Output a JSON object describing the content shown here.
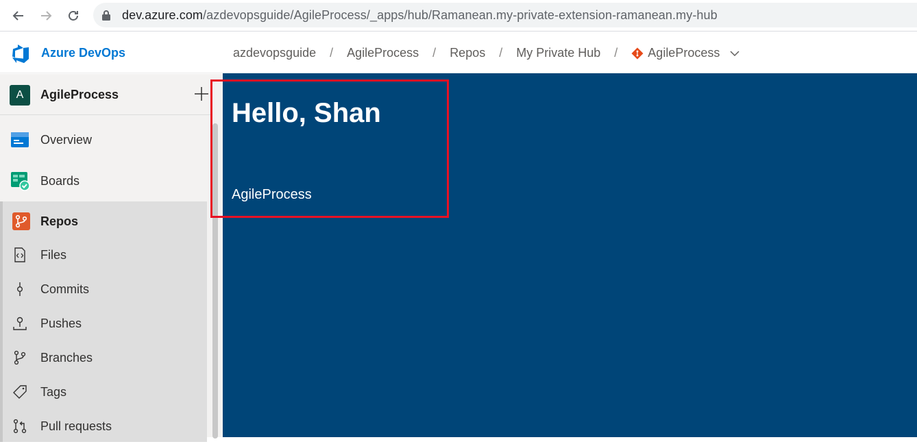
{
  "browser": {
    "url_host": "dev.azure.com",
    "url_path": "/azdevopsguide/AgileProcess/_apps/hub/Ramanean.my-private-extension-ramanean.my-hub"
  },
  "header": {
    "brand": "Azure DevOps",
    "breadcrumbs": [
      "azdevopsguide",
      "AgileProcess",
      "Repos",
      "My Private Hub"
    ],
    "separator": "/",
    "repo": "AgileProcess"
  },
  "sidebar": {
    "project_initial": "A",
    "project_name": "AgileProcess",
    "items": [
      {
        "label": "Overview",
        "icon": "overview-icon"
      },
      {
        "label": "Boards",
        "icon": "boards-icon"
      },
      {
        "label": "Repos",
        "icon": "repos-icon"
      }
    ],
    "sub_items": [
      {
        "label": "Files",
        "icon": "files-icon"
      },
      {
        "label": "Commits",
        "icon": "commits-icon"
      },
      {
        "label": "Pushes",
        "icon": "pushes-icon"
      },
      {
        "label": "Branches",
        "icon": "branches-icon"
      },
      {
        "label": "Tags",
        "icon": "tags-icon"
      },
      {
        "label": "Pull requests",
        "icon": "pull-requests-icon"
      }
    ]
  },
  "main": {
    "greeting": "Hello, Shan",
    "project": "AgileProcess"
  },
  "colors": {
    "main_bg": "#004578",
    "brand": "#0078d4",
    "highlight": "#e81123"
  }
}
